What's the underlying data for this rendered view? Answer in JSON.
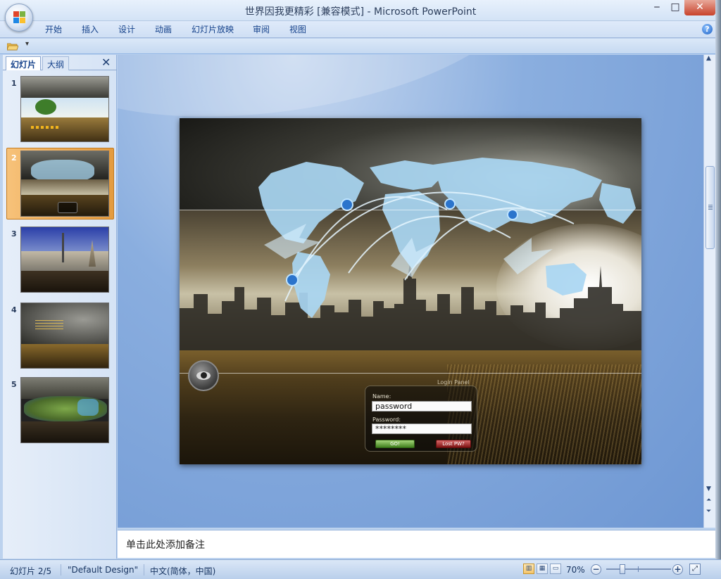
{
  "window": {
    "title": "世界因我更精彩 [兼容模式] - Microsoft PowerPoint",
    "minimize_glyph": "‒",
    "maximize_glyph": "□",
    "close_glyph": "✕"
  },
  "ribbon": {
    "tabs": [
      "开始",
      "插入",
      "设计",
      "动画",
      "幻灯片放映",
      "审阅",
      "视图"
    ],
    "help_glyph": "?"
  },
  "quick_access": {
    "dropdown_glyph": "▾"
  },
  "slides_pane": {
    "tabs": [
      "幻灯片",
      "大纲"
    ],
    "close_glyph": "✕",
    "selected_index": 1,
    "slides": [
      {
        "number": "1",
        "caption": ""
      },
      {
        "number": "2",
        "caption": ""
      },
      {
        "number": "3",
        "caption": ""
      },
      {
        "number": "4",
        "caption": ""
      },
      {
        "number": "5",
        "caption": ""
      }
    ]
  },
  "slide": {
    "login_panel_title": "Login Panel",
    "name_label": "Name:",
    "name_value": "password",
    "password_label": "Password:",
    "password_value": "********",
    "go_button": "GO!",
    "lost_button": "Lost PW?"
  },
  "notes": {
    "placeholder": "单击此处添加备注"
  },
  "status_bar": {
    "slide_indicator": "幻灯片 2/5",
    "theme": "\"Default Design\"",
    "language": "中文(简体，中国)",
    "zoom": "70%",
    "zoom_fraction": 0.25
  },
  "colors": {
    "accent_selected_thumbnail": "#e39b3f",
    "window_close": "#c8422b",
    "workspace_blue": "#6e97d3"
  }
}
